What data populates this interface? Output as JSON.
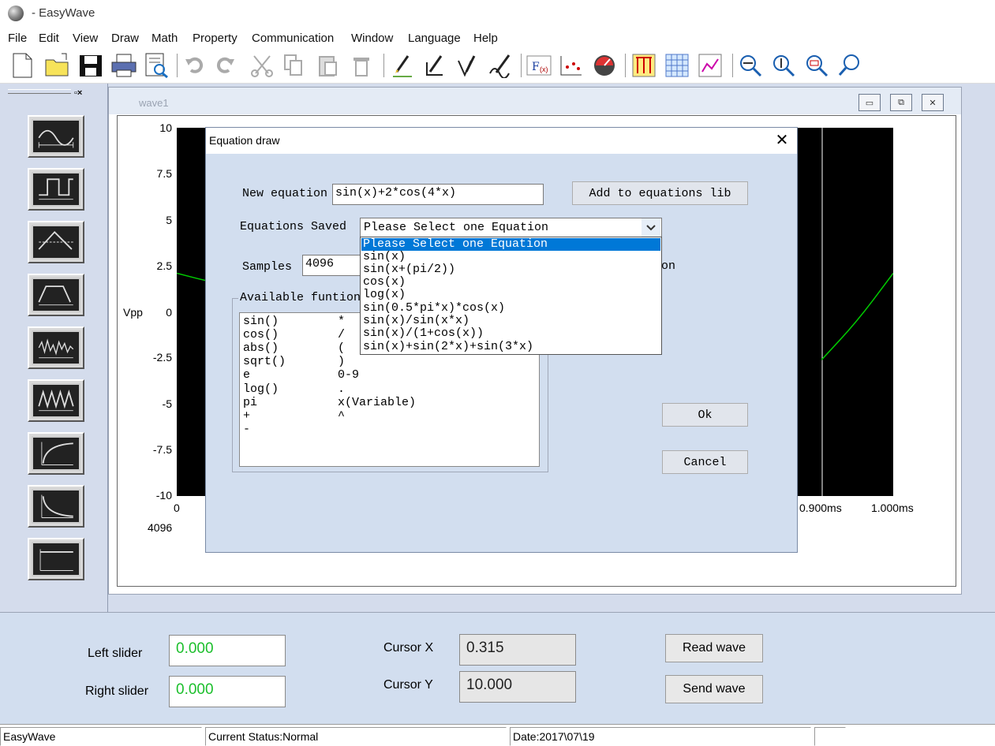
{
  "app": {
    "title": "- EasyWave"
  },
  "menu": [
    "File",
    "Edit",
    "View",
    "Draw",
    "Math",
    "Property",
    "Communication",
    "Window",
    "Language",
    "Help"
  ],
  "toolbar_icons": [
    "new-file-icon",
    "open-folder-icon",
    "save-icon",
    "print-icon",
    "print-preview-icon",
    "undo-icon",
    "redo-icon",
    "cut-icon",
    "copy-icon",
    "paste-icon",
    "delete-icon",
    "pen-line-icon",
    "pen-angle-icon",
    "pen-v-icon",
    "pen-free-icon",
    "equation-icon",
    "point-draw-icon",
    "gauge-icon",
    "marker-icon",
    "grid-icon",
    "chart-icon",
    "zoom-horizontal-icon",
    "zoom-vertical-icon",
    "zoom-in-icon",
    "zoom-reset-icon"
  ],
  "left_panel": {
    "buttons": [
      "sine-wave-icon",
      "square-wave-icon",
      "triangle-wave-icon",
      "trapezoid-wave-icon",
      "noise-wave-icon",
      "sawtooth-wave-icon",
      "exp-rise-icon",
      "exp-decay-icon",
      "dc-level-icon"
    ]
  },
  "wave_window": {
    "title": "wave1",
    "ylabel": "Vpp",
    "yticks": [
      "10",
      "7.5",
      "5",
      "2.5",
      "0",
      "-2.5",
      "-5",
      "-7.5",
      "-10"
    ],
    "xticks_left": [
      "0"
    ],
    "xticks_right": [
      "0.900ms",
      "1.000ms"
    ],
    "samples_label": "4096",
    "colors": {
      "trace": "#00cc00",
      "background": "#000000",
      "grid": "#ffffff"
    }
  },
  "chart_data": {
    "type": "line",
    "xlabel": "",
    "ylabel": "Vpp",
    "ylim": [
      -10,
      10
    ],
    "x": [
      0,
      0.05,
      0.1,
      0.9,
      0.95,
      1.0
    ],
    "series": [
      {
        "values": [
          2.1,
          1.6,
          1.2,
          -2.6,
          -0.5,
          2.1
        ]
      }
    ]
  },
  "dialog": {
    "title": "Equation draw",
    "new_equation_label": "New equation",
    "new_equation_value": "sin(x)+2*cos(4*x)",
    "add_button": "Add to equations lib",
    "saved_label": "Equations Saved",
    "saved_selected": "Please Select one Equation",
    "dropdown_items": [
      "Please Select one Equation",
      "sin(x)",
      "sin(x+(pi/2))",
      "cos(x)",
      "log(x)",
      "sin(0.5*pi*x)*cos(x)",
      "sin(x)/sin(x*x)",
      "sin(x)/(1+cos(x))",
      "sin(x)+sin(2*x)+sin(3*x)"
    ],
    "samples_label": "Samples",
    "samples_value": "4096",
    "hidden_label_tail": "on",
    "functions_label": "Available funtions",
    "functions": [
      [
        "sin()",
        "*"
      ],
      [
        "cos()",
        "/"
      ],
      [
        "abs()",
        "("
      ],
      [
        "sqrt()",
        ")"
      ],
      [
        "e",
        "0-9"
      ],
      [
        "log()",
        "."
      ],
      [
        "pi",
        "x(Variable)"
      ],
      [
        "+",
        "^"
      ],
      [
        "-",
        ""
      ]
    ],
    "ok_label": "Ok",
    "cancel_label": "Cancel"
  },
  "bottom": {
    "left_slider_label": "Left slider",
    "left_slider_value": "0.000",
    "right_slider_label": "Right slider",
    "right_slider_value": "0.000",
    "cursor_x_label": "Cursor X",
    "cursor_x_value": "0.315",
    "cursor_y_label": "Cursor Y",
    "cursor_y_value": "10.000",
    "read_wave_label": "Read wave",
    "send_wave_label": "Send wave"
  },
  "status": {
    "app": "EasyWave",
    "state": "Current Status:Normal",
    "date": "Date:2017\\07\\19"
  }
}
